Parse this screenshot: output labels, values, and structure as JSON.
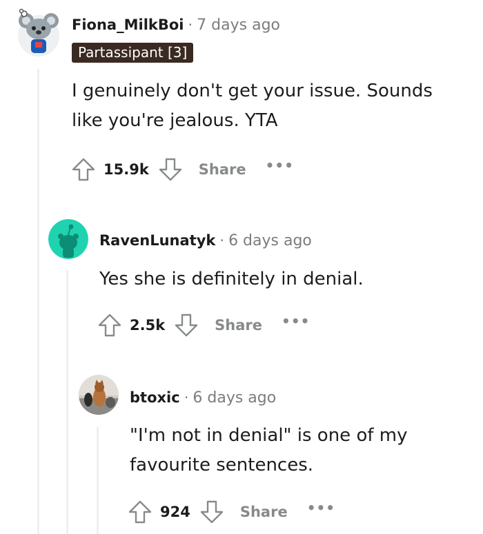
{
  "comments": [
    {
      "username": "Fiona_MilkBoi",
      "time": "7 days ago",
      "flair": "Partassipant [3]",
      "body_lines": [
        "I genuinely don't get your issue. Sounds",
        "like you're jealous. YTA"
      ],
      "score": "15.9k",
      "share_label": "Share",
      "more_label": "•••",
      "avatar_icon": "snoo-koala-avatar-icon"
    },
    {
      "username": "RavenLunatyk",
      "time": "6 days ago",
      "body_lines": [
        "Yes she is definitely in denial."
      ],
      "score": "2.5k",
      "share_label": "Share",
      "more_label": "•••",
      "avatar_icon": "snoo-default-avatar-icon",
      "avatar_color": "#1fd3b1"
    },
    {
      "username": "btoxic",
      "time": "6 days ago",
      "body_lines": [
        "\"I'm not in denial\" is one of my",
        "favourite sentences."
      ],
      "score": "924",
      "share_label": "Share",
      "more_label": "•••",
      "avatar_icon": "cat-photo-avatar-icon"
    }
  ],
  "separator": "·"
}
